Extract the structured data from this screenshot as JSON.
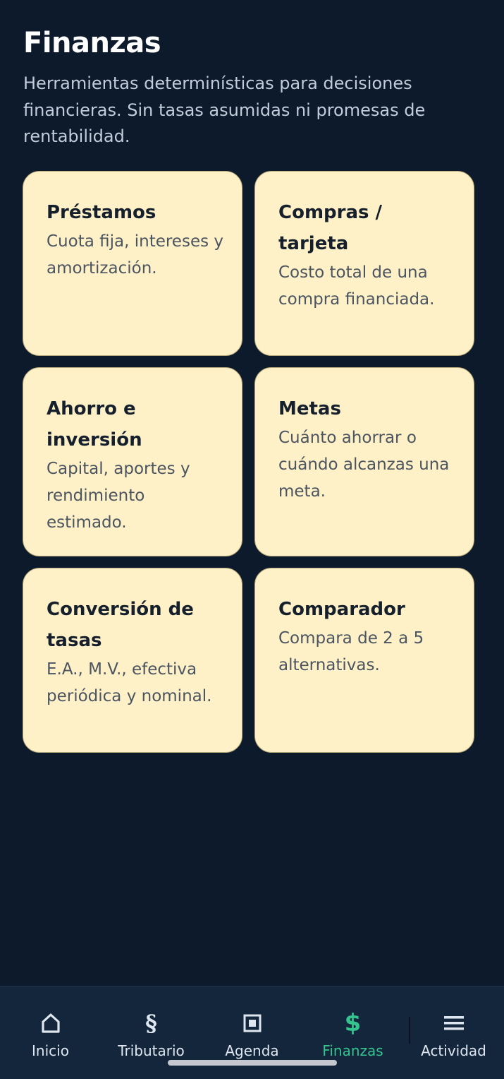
{
  "header": {
    "title": "Finanzas",
    "subtitle": "Herramientas determinísticas para decisiones financieras. Sin tasas asumidas ni promesas de rentabilidad."
  },
  "cards": [
    {
      "title": "Préstamos",
      "description": "Cuota fija, intereses y amortización."
    },
    {
      "title": "Compras / tarjeta",
      "description": "Costo total de una compra financiada."
    },
    {
      "title": "Ahorro e inversión",
      "description": "Capital, aportes y rendimiento estimado."
    },
    {
      "title": "Metas",
      "description": "Cuánto ahorrar o cuándo alcanzas una meta."
    },
    {
      "title": "Conversión de tasas",
      "description": "E.A., M.V., efectiva periódica y nominal."
    },
    {
      "title": "Comparador",
      "description": "Compara de 2 a 5 alternativas."
    }
  ],
  "nav": {
    "items": [
      {
        "label": "Inicio",
        "icon": "home-icon"
      },
      {
        "label": "Tributario",
        "icon": "section-sign-icon",
        "glyph": "§"
      },
      {
        "label": "Agenda",
        "icon": "agenda-square-icon"
      },
      {
        "label": "Finanzas",
        "icon": "dollar-icon",
        "glyph": "$",
        "active": true
      },
      {
        "label": "Actividad",
        "icon": "menu-icon"
      }
    ]
  },
  "colors": {
    "background": "#0c1a2b",
    "card": "#fff1c7",
    "nav_background": "#13263c",
    "accent": "#35c48e"
  }
}
